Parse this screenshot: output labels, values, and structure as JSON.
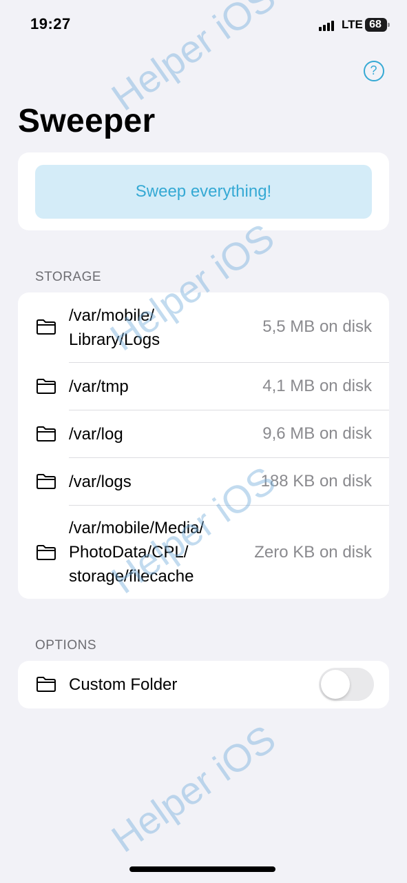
{
  "status_bar": {
    "time": "19:27",
    "network": "LTE",
    "battery": "68"
  },
  "header": {
    "title": "Sweeper",
    "help_icon": "question-circle-icon",
    "help_label": "?"
  },
  "sweep": {
    "label": "Sweep everything!"
  },
  "storage": {
    "header": "STORAGE",
    "items": [
      {
        "path_lines": [
          "/var/mobile/",
          "Library/Logs"
        ],
        "size": "5,5 MB on disk",
        "icon": "folder-icon"
      },
      {
        "path_lines": [
          "/var/tmp"
        ],
        "size": "4,1 MB on disk",
        "icon": "folder-icon"
      },
      {
        "path_lines": [
          "/var/log"
        ],
        "size": "9,6 MB on disk",
        "icon": "folder-icon"
      },
      {
        "path_lines": [
          "/var/logs"
        ],
        "size": "188 KB on disk",
        "icon": "folder-icon"
      },
      {
        "path_lines": [
          "/var/mobile/Media/",
          "PhotoData/CPL/",
          "storage/filecache"
        ],
        "size": "Zero KB on disk",
        "icon": "folder-icon"
      }
    ]
  },
  "options": {
    "header": "OPTIONS",
    "custom_folder": {
      "label": "Custom Folder",
      "enabled": false,
      "icon": "folder-icon"
    }
  },
  "watermark": "Helper iOS",
  "colors": {
    "accent": "#35a9d4",
    "background": "#f2f2f7",
    "button_bg": "#d4ecf8"
  }
}
